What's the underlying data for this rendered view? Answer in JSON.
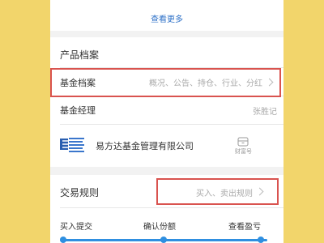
{
  "top": {
    "more_label": "查看更多"
  },
  "profile": {
    "section_title": "产品档案",
    "fund_profile_label": "基金档案",
    "fund_profile_value": "概况、公告、持仓、行业、分红",
    "manager_label": "基金经理",
    "manager_value": "张胜记",
    "company_name": "易方达基金管理有限公司",
    "fund_store_label": "财富号"
  },
  "trading": {
    "section_title": "交易规则",
    "rules_value": "买入、卖出规则",
    "steps": [
      "买入提交",
      "确认份额",
      "查看盈亏"
    ]
  },
  "colors": {
    "background": "#f2d56b",
    "link": "#2f72c8",
    "highlight": "#d9534f",
    "progress": "#2f8fe0"
  }
}
